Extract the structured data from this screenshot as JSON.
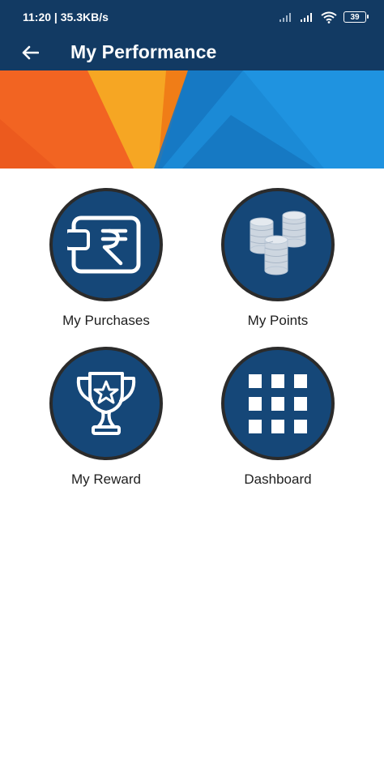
{
  "status_bar": {
    "time_speed": "11:20 | 35.3KB/s",
    "battery": "39",
    "icons": [
      "signal-icon",
      "signal-icon",
      "wifi-icon",
      "battery-icon"
    ]
  },
  "app_bar": {
    "title": "My Performance",
    "back_icon": "arrow-left-icon"
  },
  "colors": {
    "primary": "#123a63",
    "tile_fill": "#154778",
    "tile_border": "#2b2b2b",
    "banner_orange": "#f26422",
    "banner_yellow": "#f6a623",
    "banner_blue": "#1b8ad6"
  },
  "menu": {
    "items": [
      {
        "label": "My Purchases",
        "icon": "wallet-rupee-icon"
      },
      {
        "label": "My Points",
        "icon": "coins-icon"
      },
      {
        "label": "My Reward",
        "icon": "trophy-icon"
      },
      {
        "label": "Dashboard",
        "icon": "grid-icon"
      }
    ]
  }
}
